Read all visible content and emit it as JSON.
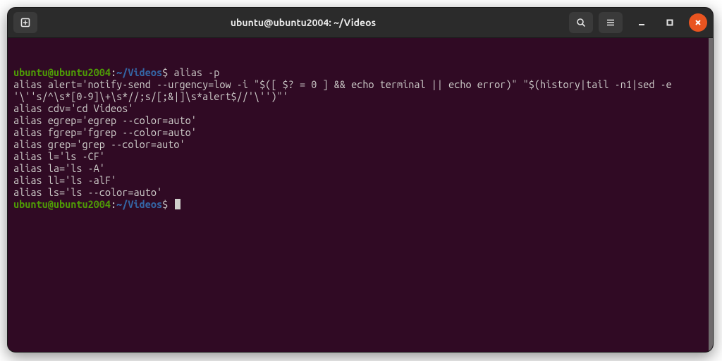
{
  "window": {
    "title": "ubuntu@ubuntu2004: ~/Videos"
  },
  "prompt": {
    "user_host": "ubuntu@ubuntu2004",
    "sep": ":",
    "path": "~/Videos",
    "symbol": "$"
  },
  "typed_command": "alias -p",
  "output_lines": [
    "alias alert='notify-send --urgency=low -i \"$([ $? = 0 ] && echo terminal || echo error)\" \"$(history|tail -n1|sed -e '\\''s/^\\s*[0-9]\\+\\s*//;s/[;&|]\\s*alert$//'\\'')\"'",
    "alias cdv='cd Videos'",
    "alias egrep='egrep --color=auto'",
    "alias fgrep='fgrep --color=auto'",
    "alias grep='grep --color=auto'",
    "alias l='ls -CF'",
    "alias la='ls -A'",
    "alias ll='ls -alF'",
    "alias ls='ls --color=auto'"
  ],
  "colors": {
    "background": "#300a24",
    "titlebar": "#2b2b2b",
    "text": "#d0cfcc",
    "prompt_user": "#4e9a06",
    "prompt_path": "#3465a4",
    "close_button": "#e95420"
  }
}
